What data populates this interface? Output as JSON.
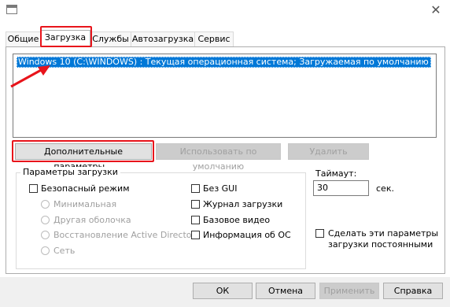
{
  "window": {
    "close_glyph": "✕"
  },
  "tabs": [
    {
      "label": "Общие"
    },
    {
      "label": "Загрузка"
    },
    {
      "label": "Службы"
    },
    {
      "label": "Автозагрузка"
    },
    {
      "label": "Сервис"
    }
  ],
  "boot_list": [
    "Windows 10 (C:\\WINDOWS) : Текущая операционная система; Загружаемая по умолчанию ОС"
  ],
  "list_buttons": {
    "advanced": "Дополнительные параметры...",
    "set_default": "Использовать по умолчанию",
    "delete": "Удалить"
  },
  "boot_options": {
    "title": "Параметры загрузки",
    "safe_boot": "Безопасный режим",
    "minimal": "Минимальная",
    "alt_shell": "Другая оболочка",
    "ad_repair": "Восстановление Active Directory",
    "network": "Сеть",
    "no_gui": "Без GUI",
    "boot_log": "Журнал загрузки",
    "base_video": "Базовое видео",
    "os_info": "Информация  об ОС"
  },
  "timeout": {
    "label": "Таймаут:",
    "value": "30",
    "unit": "сек."
  },
  "persistent": {
    "line1": "Сделать эти параметры",
    "line2": "загрузки постоянными"
  },
  "footer_buttons": {
    "ok": "ОК",
    "cancel": "Отмена",
    "apply": "Применить",
    "help": "Справка"
  },
  "colors": {
    "highlight_box": "#e8141b",
    "selection": "#0078d7"
  }
}
